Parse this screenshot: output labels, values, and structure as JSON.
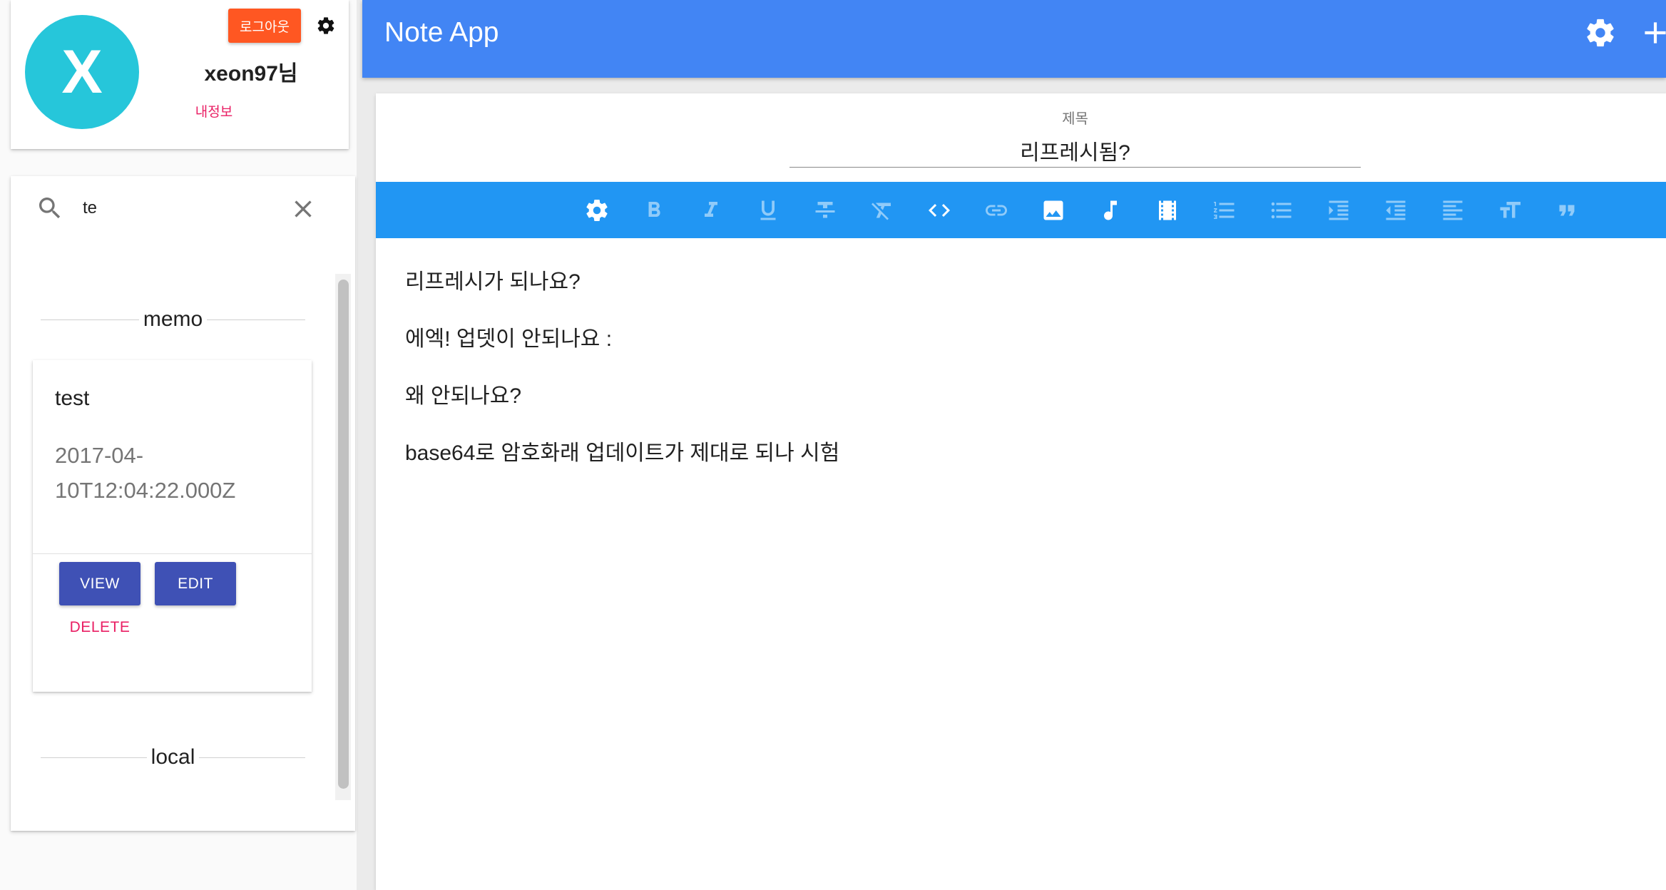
{
  "app": {
    "title": "Note App",
    "settings_icon": "gear-icon",
    "add_icon": "add-icon"
  },
  "profile": {
    "avatar_letter": "X",
    "username": "xeon97님",
    "my_info_link": "내정보",
    "logout_button": "로그아웃",
    "settings_icon": "gear-icon"
  },
  "search": {
    "value": "te",
    "search_icon": "search-icon",
    "clear_icon": "close-icon"
  },
  "notes_list": {
    "sections": [
      {
        "label": "memo"
      },
      {
        "label": "local"
      }
    ],
    "memo_items": [
      {
        "title": "test",
        "date": "2017-04-10T12:04:22.000Z",
        "view_button": "VIEW",
        "edit_button": "EDIT",
        "delete_button": "DELETE"
      }
    ]
  },
  "editor": {
    "title_label": "제목",
    "title_value": "리프레시됨?",
    "toolbar": [
      {
        "icon": "gear-icon",
        "active": true
      },
      {
        "icon": "bold-icon",
        "active": false
      },
      {
        "icon": "italic-icon",
        "active": false
      },
      {
        "icon": "underline-icon",
        "active": false
      },
      {
        "icon": "strikethrough-icon",
        "active": false
      },
      {
        "icon": "clear-format-icon",
        "active": false
      },
      {
        "icon": "code-icon",
        "active": true
      },
      {
        "icon": "link-icon",
        "active": false
      },
      {
        "icon": "image-icon",
        "active": true
      },
      {
        "icon": "music-note-icon",
        "active": true
      },
      {
        "icon": "video-icon",
        "active": true
      },
      {
        "icon": "ordered-list-icon",
        "active": false
      },
      {
        "icon": "bullet-list-icon",
        "active": false
      },
      {
        "icon": "indent-icon",
        "active": false
      },
      {
        "icon": "outdent-icon",
        "active": false
      },
      {
        "icon": "align-left-icon",
        "active": false
      },
      {
        "icon": "text-size-icon",
        "active": false
      },
      {
        "icon": "quote-icon",
        "active": false
      }
    ],
    "content": [
      "리프레시가 되나요?",
      "에엑! 업뎃이 안되나요 :",
      "왜 안되나요?",
      "base64로 암호화래 업데이트가 제대로 되나 시험"
    ]
  },
  "colors": {
    "header": "#4285f4",
    "toolbar": "#2196f3",
    "avatar": "#26c6da",
    "logout": "#ff5722",
    "accent": "#e91e63",
    "primary_button": "#3f51b5"
  }
}
